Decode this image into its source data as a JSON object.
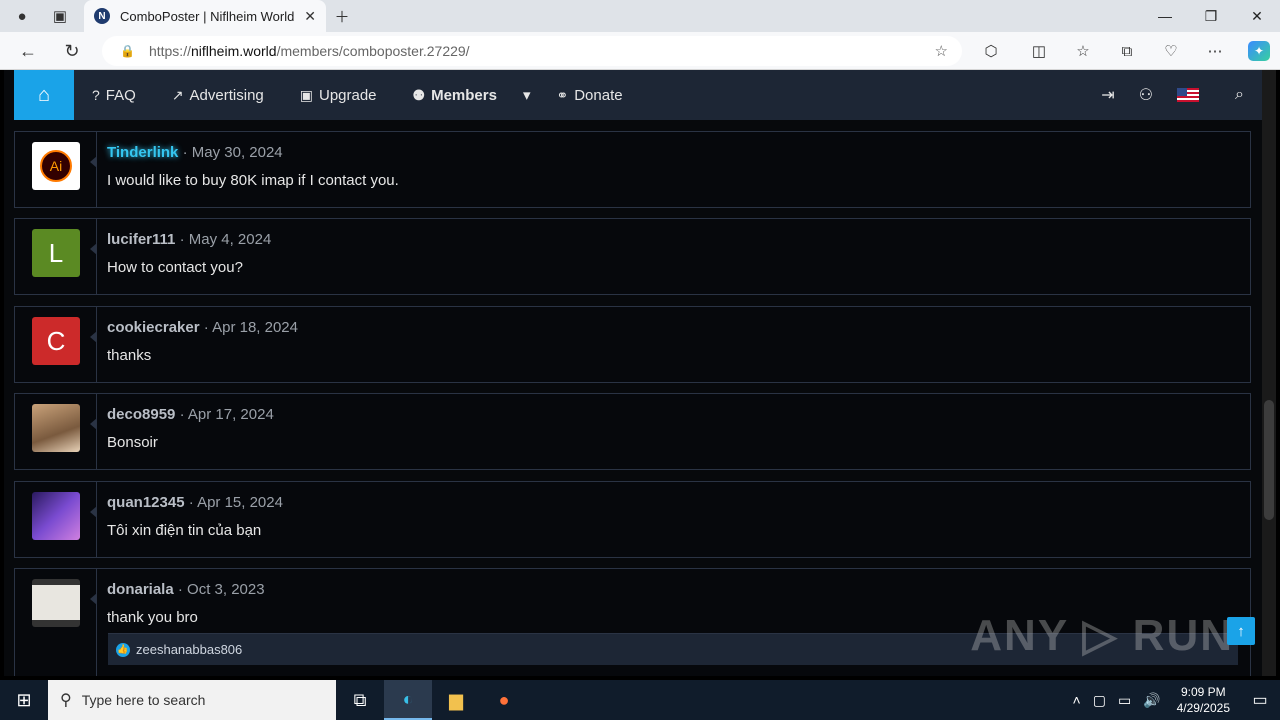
{
  "browser": {
    "tab_title": "ComboPoster | Niflheim World",
    "tab_favicon": "N",
    "url_prefix": "https://",
    "url_host": "niflheim.world",
    "url_path": "/members/comboposter.27229/"
  },
  "nav": {
    "faq": "FAQ",
    "advertising": "Advertising",
    "upgrade": "Upgrade",
    "members": "Members",
    "donate": "Donate"
  },
  "posts": [
    {
      "username": "Tinderlink",
      "date": "May 30, 2024",
      "text": "I would like to buy 80K imap if I contact you.",
      "avatar": "Ai"
    },
    {
      "username": "lucifer111",
      "date": "May 4, 2024",
      "text": "How to contact you?",
      "avatar": "L"
    },
    {
      "username": "cookiecraker",
      "date": "Apr 18, 2024",
      "text": "thanks",
      "avatar": "C"
    },
    {
      "username": "deco8959",
      "date": "Apr 17, 2024",
      "text": "Bonsoir",
      "avatar": ""
    },
    {
      "username": "quan12345",
      "date": "Apr 15, 2024",
      "text": "Tôi xin điện tin của bạn",
      "avatar": ""
    },
    {
      "username": "donariala",
      "date": "Oct 3, 2023",
      "text": "thank you bro",
      "avatar": "",
      "liked_by": "zeeshanabbas806"
    }
  ],
  "separator": "·",
  "watermark": "ANY ▷ RUN",
  "taskbar": {
    "search_placeholder": "Type here to search",
    "time": "9:09 PM",
    "date": "4/29/2025"
  },
  "colors": {
    "accent": "#1aa3e8",
    "nav_bg": "#1d2635",
    "glow_username": "#35c6f0"
  }
}
